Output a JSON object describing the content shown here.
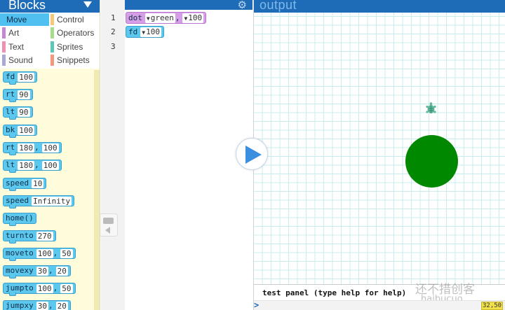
{
  "palette": {
    "title": "Blocks",
    "categories": [
      {
        "label": "Move",
        "color": "#4fc0ef",
        "selected": true
      },
      {
        "label": "Control",
        "color": "#f5c87a"
      },
      {
        "label": "Art",
        "color": "#c586d6"
      },
      {
        "label": "Operators",
        "color": "#a6dc8a"
      },
      {
        "label": "Text",
        "color": "#f08fb0"
      },
      {
        "label": "Sprites",
        "color": "#5cc7b4"
      },
      {
        "label": "Sound",
        "color": "#a9a9d6"
      },
      {
        "label": "Snippets",
        "color": "#f39a7e"
      }
    ],
    "blocks": [
      {
        "cmd": "fd",
        "args": [
          "100"
        ]
      },
      {
        "cmd": "rt",
        "args": [
          "90"
        ]
      },
      {
        "cmd": "lt",
        "args": [
          "90"
        ]
      },
      {
        "cmd": "bk",
        "args": [
          "100"
        ]
      },
      {
        "cmd": "rt",
        "args": [
          "180",
          "100"
        ]
      },
      {
        "cmd": "lt",
        "args": [
          "180",
          "100"
        ]
      },
      {
        "cmd": "speed",
        "args": [
          "10"
        ]
      },
      {
        "cmd": "speed",
        "args": [
          "Infinity"
        ]
      },
      {
        "cmd": "home()",
        "args": []
      },
      {
        "cmd": "turnto",
        "args": [
          "270"
        ]
      },
      {
        "cmd": "moveto",
        "args": [
          "100",
          "50"
        ]
      },
      {
        "cmd": "movexy",
        "args": [
          "30",
          "20"
        ]
      },
      {
        "cmd": "jumpto",
        "args": [
          "100",
          "50"
        ]
      },
      {
        "cmd": "jumpxy",
        "args": [
          "30",
          "20"
        ]
      }
    ]
  },
  "editor": {
    "line_numbers": [
      "1",
      "2",
      "3"
    ],
    "line1": {
      "cmd": "dot",
      "arg1": "green",
      "arg2": "100"
    },
    "line2": {
      "cmd": "fd",
      "arg1": "100"
    }
  },
  "output": {
    "title": "output",
    "dot_color": "#008800",
    "turtle_color": "#5fb89a",
    "test_panel": "test panel (type help for help)",
    "prompt": ">",
    "watermark_cn": "还不措创客",
    "watermark_url": "haibucuo.",
    "coord": "32,50"
  }
}
